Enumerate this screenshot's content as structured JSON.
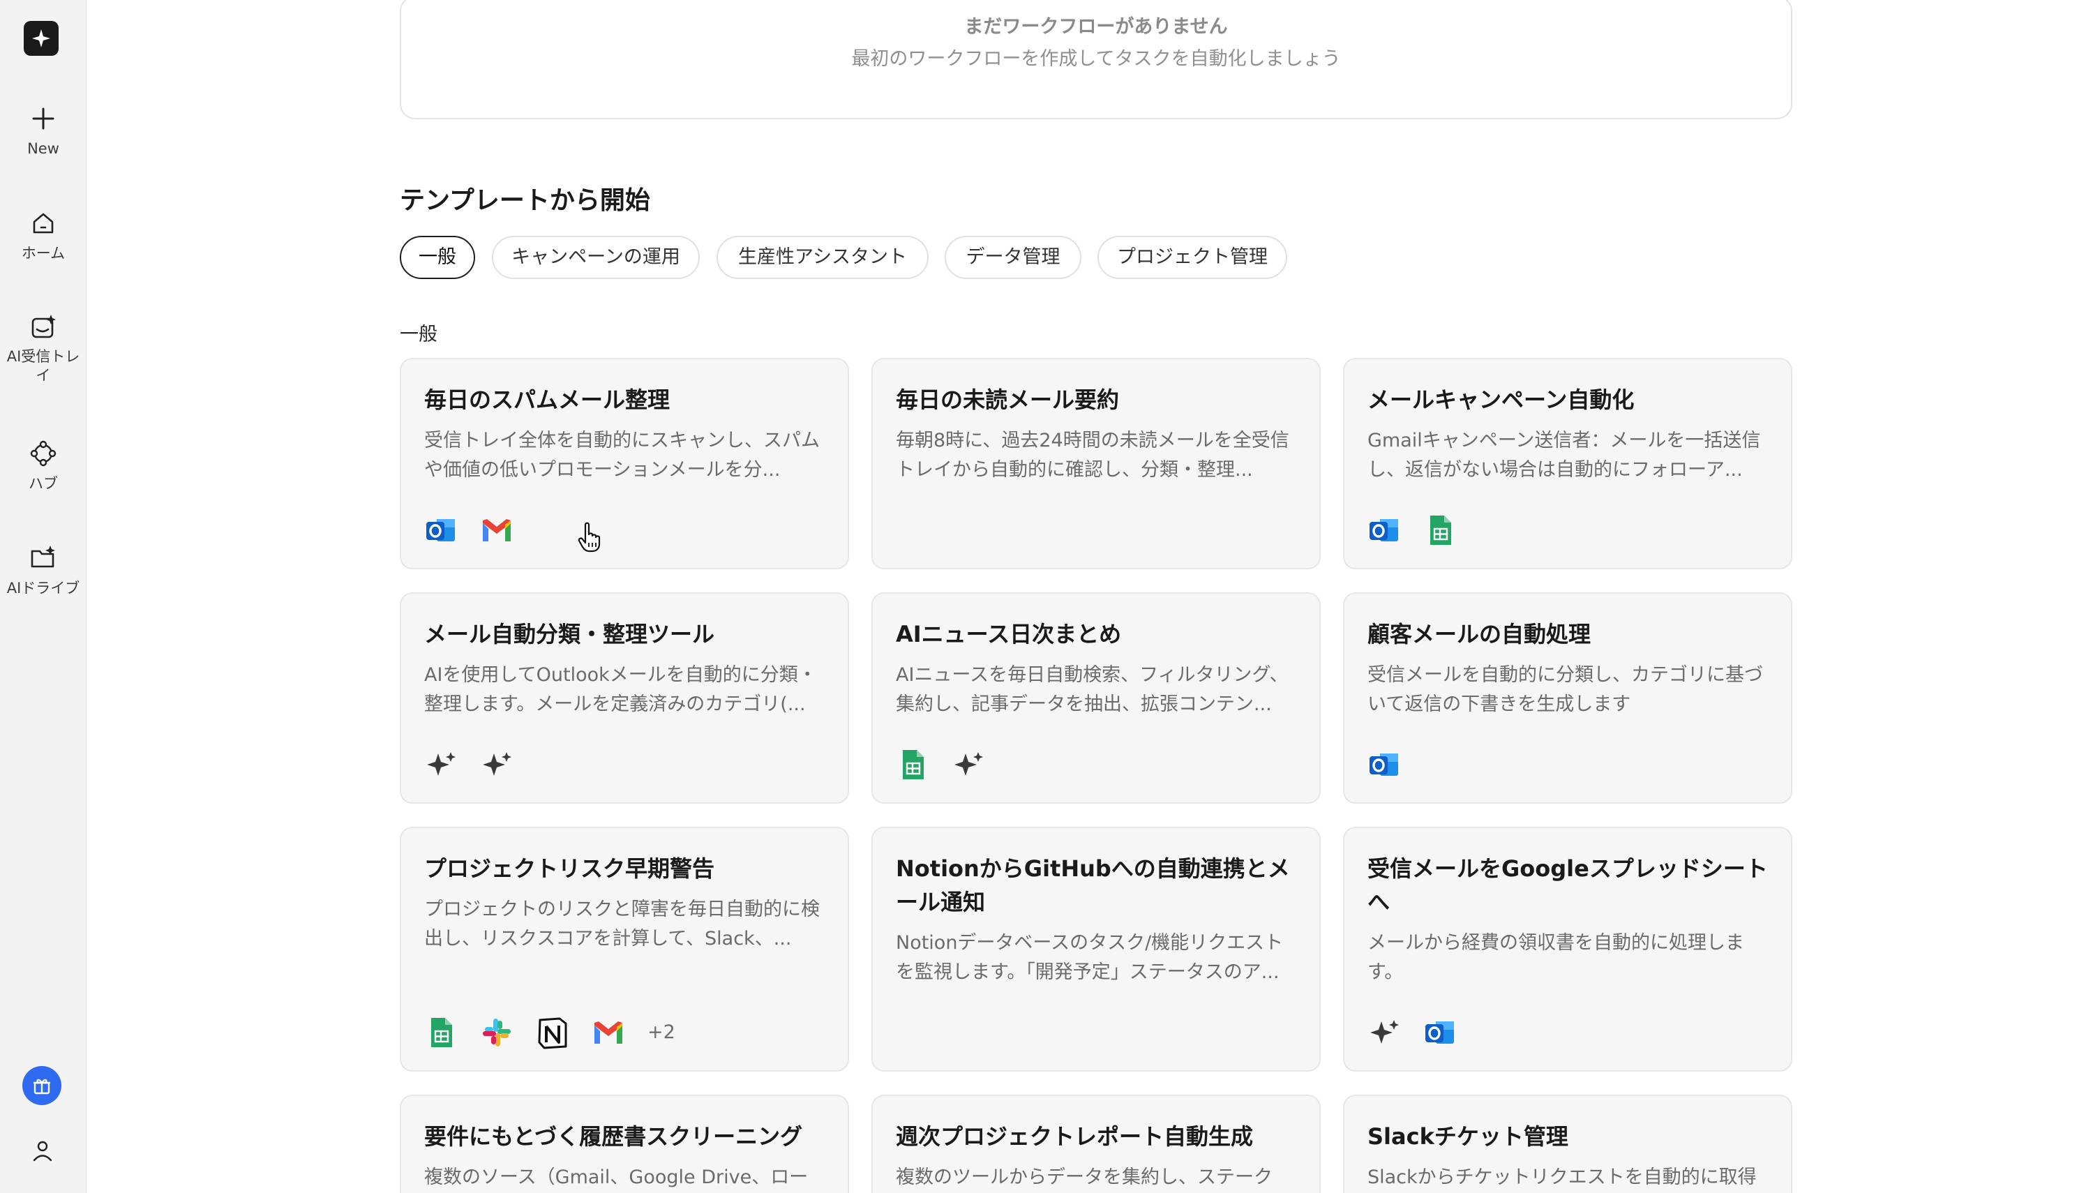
{
  "sidebar": {
    "items": [
      {
        "label": "New",
        "icon": "plus-icon"
      },
      {
        "label": "ホーム",
        "icon": "home-icon"
      },
      {
        "label": "AI受信トレイ",
        "icon": "ai-inbox-icon"
      },
      {
        "label": "ハブ",
        "icon": "hub-icon"
      },
      {
        "label": "AIドライブ",
        "icon": "ai-drive-icon"
      }
    ]
  },
  "workflows": {
    "empty_title": "まだワークフローがありません",
    "empty_subtitle": "最初のワークフローを作成してタスクを自動化しましょう"
  },
  "templates": {
    "section_title": "テンプレートから開始",
    "tabs": [
      "一般",
      "キャンペーンの運用",
      "生産性アシスタント",
      "データ管理",
      "プロジェクト管理"
    ],
    "active_tab": "一般",
    "group_label": "一般",
    "cards": [
      {
        "title": "毎日のスパムメール整理",
        "description": "受信トレイ全体を自動的にスキャンし、スパムや価値の低いプロモーションメールを分...",
        "icons": [
          "outlook-icon",
          "gmail-icon"
        ]
      },
      {
        "title": "毎日の未読メール要約",
        "description": "毎朝8時に、過去24時間の未読メールを全受信トレイから自動的に確認し、分類・整理...",
        "icons": []
      },
      {
        "title": "メールキャンペーン自動化",
        "description": "Gmailキャンペーン送信者：メールを一括送信し、返信がない場合は自動的にフォローア...",
        "icons": [
          "outlook-icon",
          "google-sheets-icon"
        ]
      },
      {
        "title": "メール自動分類・整理ツール",
        "description": "AIを使用してOutlookメールを自動的に分類・整理します。メールを定義済みのカテゴリ(...",
        "icons": [
          "ai-sparkle-icon",
          "ai-sparkle-icon"
        ]
      },
      {
        "title": "AIニュース日次まとめ",
        "description": "AIニュースを毎日自動検索、フィルタリング、集約し、記事データを抽出、拡張コンテン...",
        "icons": [
          "google-sheets-icon",
          "ai-sparkle-icon"
        ]
      },
      {
        "title": "顧客メールの自動処理",
        "description": "受信メールを自動的に分類し、カテゴリに基づいて返信の下書きを生成します",
        "icons": [
          "outlook-icon"
        ]
      },
      {
        "title": "プロジェクトリスク早期警告",
        "description": "プロジェクトのリスクと障害を毎日自動的に検出し、リスクスコアを計算して、Slack、...",
        "icons": [
          "google-sheets-icon",
          "slack-icon",
          "notion-icon",
          "gmail-icon"
        ],
        "more": "+2"
      },
      {
        "title": "NotionからGitHubへの自動連携とメール通知",
        "description": "Notionデータベースのタスク/機能リクエストを監視します。「開発予定」ステータスのア...",
        "icons": []
      },
      {
        "title": "受信メールをGoogleスプレッドシートへ",
        "description": "メールから経費の領収書を自動的に処理します。",
        "icons": [
          "ai-sparkle-icon",
          "outlook-icon"
        ]
      },
      {
        "title": "要件にもとづく履歴書スクリーニング",
        "description": "複数のソース（Gmail、Google Drive、ローカ",
        "icons": []
      },
      {
        "title": "週次プロジェクトレポート自動生成",
        "description": "複数のツールからデータを集約し、ステーク",
        "icons": []
      },
      {
        "title": "Slackチケット管理",
        "description": "Slackからチケットリクエストを自動的に取得",
        "icons": []
      }
    ]
  }
}
